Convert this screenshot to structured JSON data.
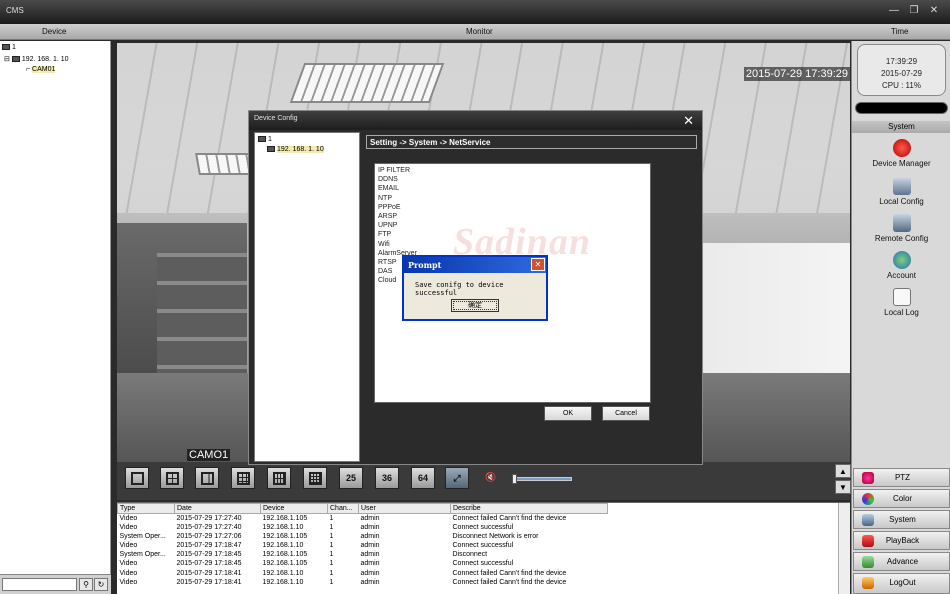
{
  "app": {
    "title": "CMS"
  },
  "headers": {
    "device": "Device",
    "monitor": "Monitor",
    "time": "Time"
  },
  "device_tree": {
    "root": "1",
    "device": "192. 168. 1. 10",
    "channel": "CAM01"
  },
  "video": {
    "osd_time": "2015-07-29 17:39:29",
    "osd_channel": "CAMO1"
  },
  "clock": {
    "time": "17:39:29",
    "date": "2015-07-29",
    "cpu": "CPU : 11%"
  },
  "system_panel": {
    "header": "System",
    "tools": [
      "Device Manager",
      "Local Config",
      "Remote Config",
      "Account",
      "Local Log"
    ]
  },
  "menu": [
    "PTZ",
    "Color",
    "System",
    "PlayBack",
    "Advance",
    "LogOut"
  ],
  "toolbar": {
    "split25": "25",
    "split36": "36",
    "split64": "64"
  },
  "log": {
    "columns": [
      "Type",
      "Date",
      "Device",
      "Chan...",
      "User",
      "Describe"
    ],
    "rows": [
      [
        "Video",
        "2015-07-29 17:27:40",
        "192.168.1.105",
        "1",
        "admin",
        "Connect failed Cann't find the device"
      ],
      [
        "Video",
        "2015-07-29 17:27:40",
        "192.168.1.10",
        "1",
        "admin",
        "Connect successful"
      ],
      [
        "System Oper...",
        "2015-07-29 17:27:06",
        "192.168.1.105",
        "1",
        "admin",
        "Disconnect Network is error"
      ],
      [
        "Video",
        "2015-07-29 17:18:47",
        "192.168.1.10",
        "1",
        "admin",
        "Connect successful"
      ],
      [
        "System Oper...",
        "2015-07-29 17:18:45",
        "192.168.1.105",
        "1",
        "admin",
        "Disconnect"
      ],
      [
        "Video",
        "2015-07-29 17:18:45",
        "192.168.1.105",
        "1",
        "admin",
        "Connect successful"
      ],
      [
        "Video",
        "2015-07-29 17:18:41",
        "192.168.1.10",
        "1",
        "admin",
        "Connect failed Cann't find the device"
      ],
      [
        "Video",
        "2015-07-29 17:18:41",
        "192.168.1.10",
        "1",
        "admin",
        "Connect failed Cann't find the device"
      ]
    ]
  },
  "device_config": {
    "title": "Device Config",
    "tree_root": "1",
    "tree_device": "192. 168. 1. 10",
    "breadcrumb": "Setting -> System -> NetService",
    "services": [
      "IP FILTER",
      "DDNS",
      "EMAIL",
      "NTP",
      "PPPoE",
      "ARSP",
      "UPNP",
      "FTP",
      "Wifi",
      "AlarmServer",
      "RTSP",
      "DAS",
      "Cloud"
    ],
    "ok_label": "OK",
    "cancel_label": "Cancel",
    "watermark": "Sadinan"
  },
  "prompt": {
    "title": "Prompt",
    "message": "Save conifg to device successful",
    "ok_label": "确定"
  }
}
